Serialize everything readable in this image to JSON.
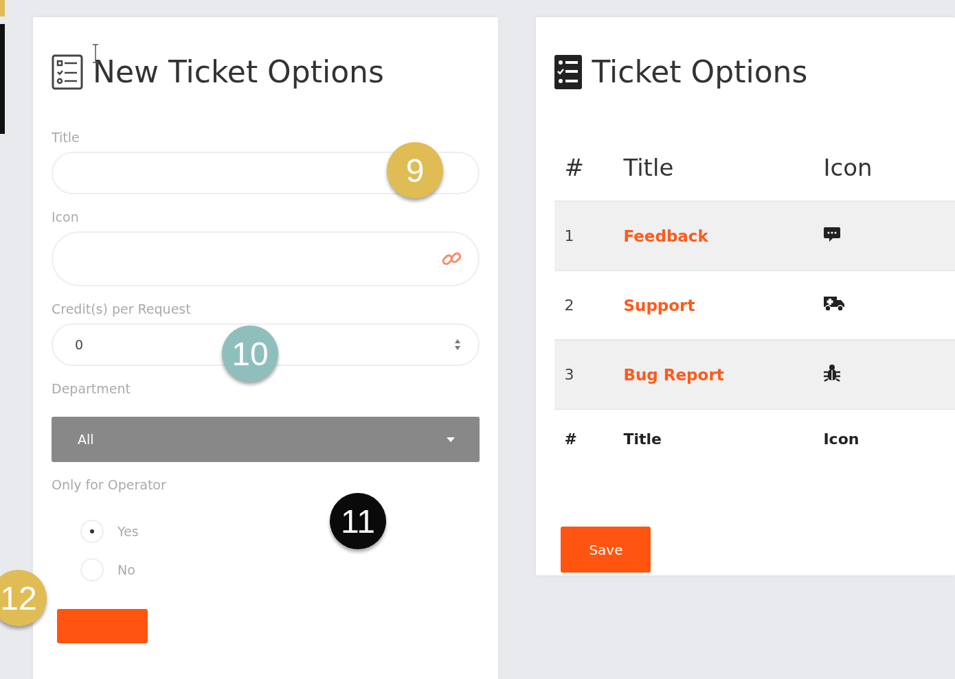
{
  "new_ticket_options": {
    "title": "New Ticket Options",
    "fields": [
      {
        "kind": "text",
        "label": "Title"
      },
      {
        "kind": "link",
        "label": "Icon"
      },
      {
        "kind": "number",
        "label": "Credit(s) per Request",
        "value": "0"
      },
      {
        "kind": "select",
        "label": "Department",
        "value": "All"
      }
    ],
    "only_for_operator": {
      "label": "Only for Operator",
      "options": [
        {
          "label": "Yes",
          "selected": true
        },
        {
          "label": "No",
          "selected": false
        }
      ]
    }
  },
  "ticket_options": {
    "title": "Ticket Options",
    "columns": [
      "#",
      "Title",
      "Icon"
    ],
    "rows": [
      {
        "number": "1",
        "title": "Feedback",
        "kind": "chat"
      },
      {
        "number": "2",
        "title": "Support",
        "kind": "truck"
      },
      {
        "number": "3",
        "title": "Bug Report",
        "kind": "bug"
      }
    ],
    "footer": [
      "#",
      "Title",
      "Icon"
    ],
    "save_button": "Save"
  },
  "annotations": [
    {
      "label": "9",
      "color": "#e0bc55"
    },
    {
      "label": "10",
      "color": "#8fbfbd"
    },
    {
      "label": "11",
      "color": "#0a0a0a"
    },
    {
      "label": "12",
      "color": "#e0bc55"
    }
  ]
}
